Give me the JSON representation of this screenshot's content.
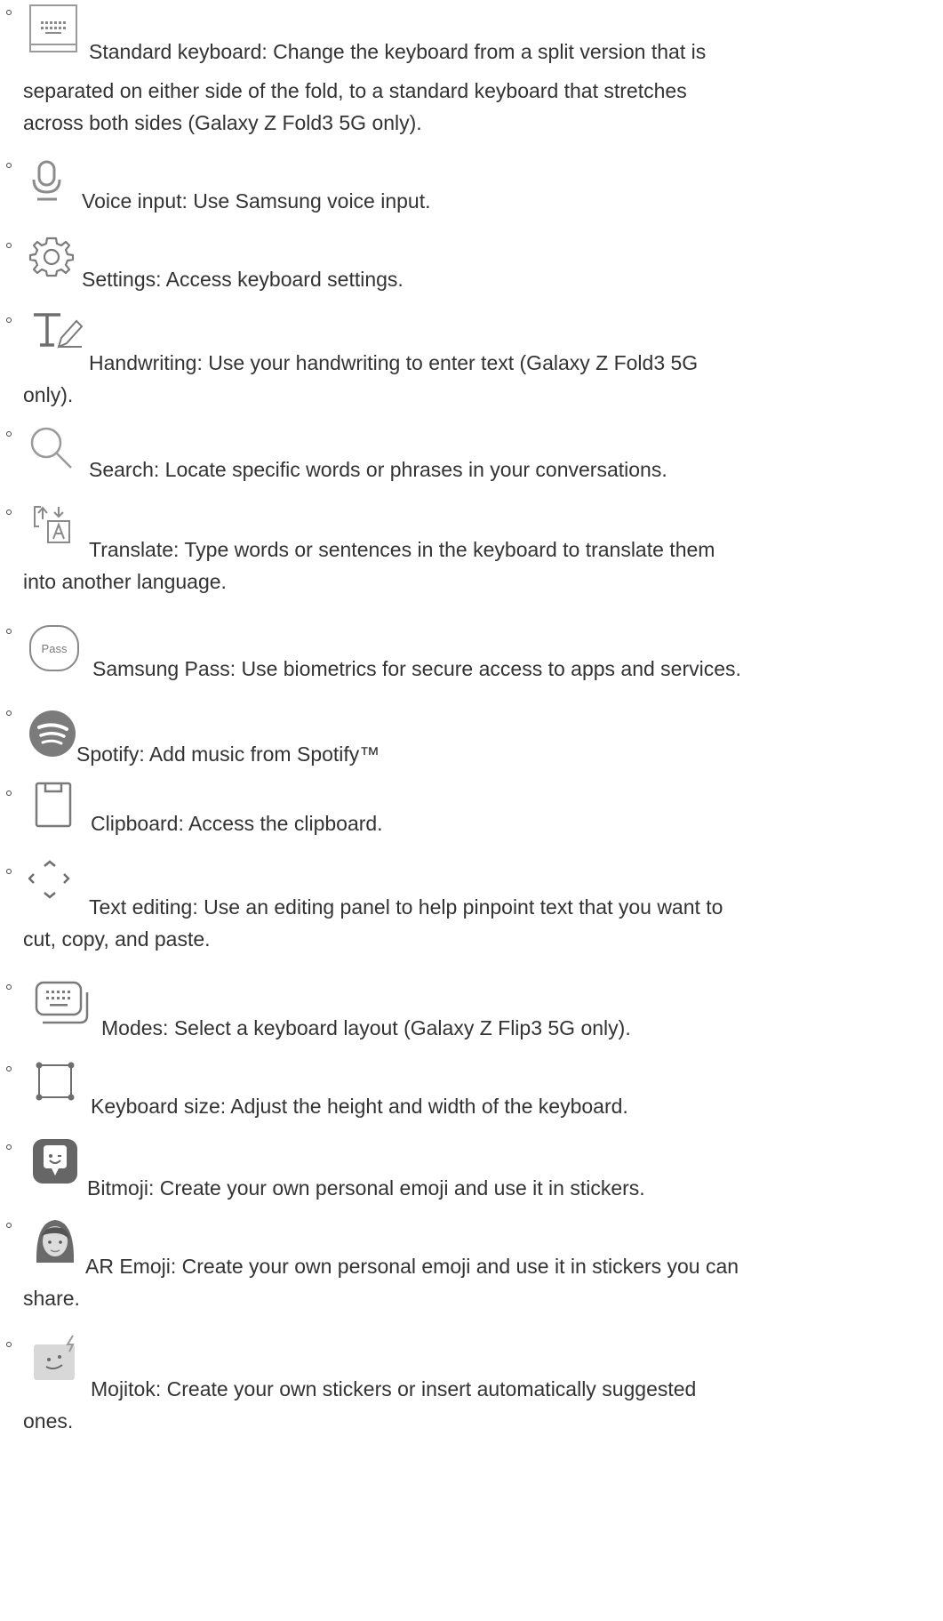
{
  "items": [
    {
      "icon": "standard-keyboard-icon",
      "lines": [
        "Standard keyboard: Change the keyboard from a split version that is",
        "separated on either side of the fold, to a standard keyboard that stretches",
        "across both sides (Galaxy Z Fold3 5G only)."
      ]
    },
    {
      "icon": "microphone-icon",
      "lines": [
        "Voice input: Use Samsung voice input."
      ]
    },
    {
      "icon": "gear-icon",
      "lines": [
        "Settings: Access keyboard settings."
      ]
    },
    {
      "icon": "handwriting-icon",
      "lines": [
        "Handwriting: Use your handwriting to enter text (Galaxy Z Fold3 5G",
        "only)."
      ]
    },
    {
      "icon": "search-icon",
      "lines": [
        "Search: Locate specific words or phrases in your conversations."
      ]
    },
    {
      "icon": "translate-icon",
      "lines": [
        "Translate: Type words or sentences in the keyboard to translate them",
        "into another language."
      ]
    },
    {
      "icon": "samsung-pass-icon",
      "icon_text": "Pass",
      "lines": [
        "Samsung Pass: Use biometrics for secure access to apps and services."
      ]
    },
    {
      "icon": "spotify-icon",
      "lines": [
        "Spotify: Add music from Spotify™"
      ]
    },
    {
      "icon": "clipboard-icon",
      "lines": [
        "Clipboard: Access the clipboard."
      ]
    },
    {
      "icon": "text-editing-icon",
      "lines": [
        "Text editing: Use an editing panel to help pinpoint text that you want to",
        "cut, copy, and paste."
      ]
    },
    {
      "icon": "modes-keyboard-icon",
      "lines": [
        "Modes: Select a keyboard layout (Galaxy Z Flip3 5G only)."
      ]
    },
    {
      "icon": "keyboard-size-icon",
      "lines": [
        "Keyboard size: Adjust the height and width of the keyboard."
      ]
    },
    {
      "icon": "bitmoji-icon",
      "lines": [
        "Bitmoji: Create your own personal emoji and use it in stickers."
      ]
    },
    {
      "icon": "ar-emoji-icon",
      "lines": [
        "AR Emoji: Create your own personal emoji and use it in stickers you can",
        "share."
      ]
    },
    {
      "icon": "mojitok-icon",
      "lines": [
        "Mojitok: Create your own stickers or insert automatically suggested",
        "ones."
      ]
    }
  ]
}
